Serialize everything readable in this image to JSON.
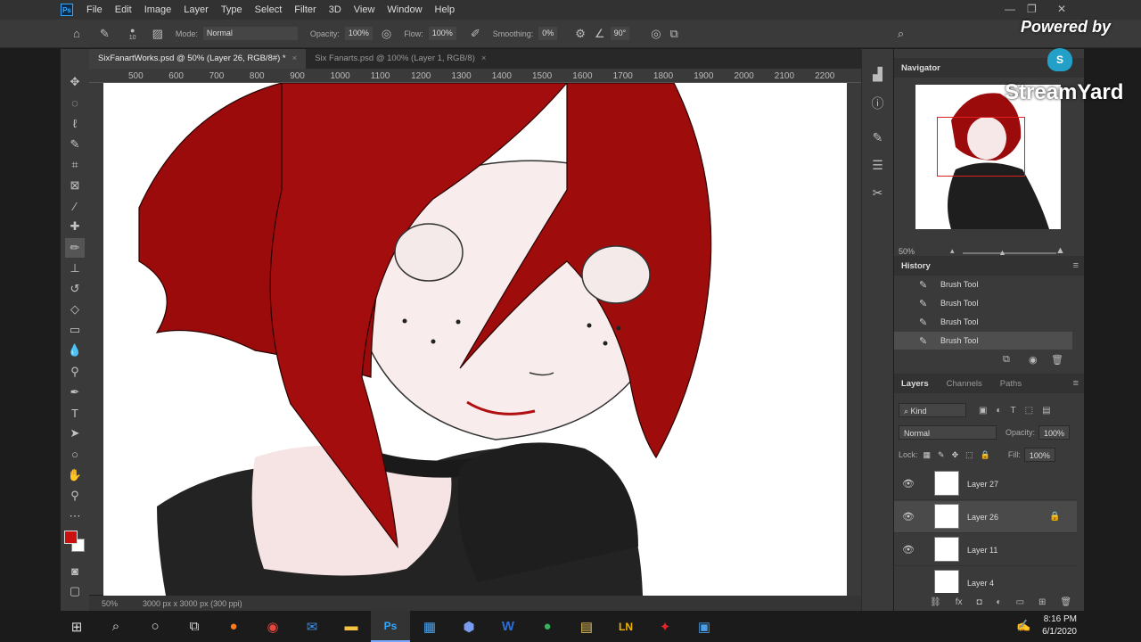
{
  "menubar": {
    "items": [
      "File",
      "Edit",
      "Image",
      "Layer",
      "Type",
      "Select",
      "Filter",
      "3D",
      "View",
      "Window",
      "Help"
    ],
    "logo": "Ps"
  },
  "options": {
    "brush_size": "10",
    "mode_label": "Mode:",
    "mode_value": "Normal",
    "opacity_label": "Opacity:",
    "opacity_value": "100%",
    "flow_label": "Flow:",
    "flow_value": "100%",
    "smoothing_label": "Smoothing:",
    "smoothing_value": "0%",
    "angle_value": "90°"
  },
  "tabs": [
    {
      "label": "SixFanartWorks.psd @ 50% (Layer 26, RGB/8#) *",
      "active": true
    },
    {
      "label": "Six Fanarts.psd @ 100% (Layer 1, RGB/8)",
      "active": false
    }
  ],
  "ruler": {
    "ticks": [
      "500",
      "600",
      "700",
      "800",
      "900",
      "1000",
      "1100",
      "1200",
      "1300",
      "1400",
      "1500",
      "1600",
      "1700",
      "1800",
      "1900",
      "2000",
      "2100",
      "2200"
    ]
  },
  "status": {
    "zoom": "50%",
    "doc_size": "3000 px x 3000 px (300 ppi)"
  },
  "navigator": {
    "title": "Navigator",
    "zoom": "50%"
  },
  "history": {
    "title": "History",
    "items": [
      "Brush Tool",
      "Brush Tool",
      "Brush Tool",
      "Brush Tool"
    ]
  },
  "layers": {
    "tab_layers": "Layers",
    "tab_channels": "Channels",
    "tab_paths": "Paths",
    "kind_label": "Kind",
    "blend_mode": "Normal",
    "opacity_label": "Opacity:",
    "opacity_value": "100%",
    "lock_label": "Lock:",
    "fill_label": "Fill:",
    "fill_value": "100%",
    "items": [
      {
        "name": "Layer 27"
      },
      {
        "name": "Layer 26"
      },
      {
        "name": "Layer 11"
      },
      {
        "name": "Layer 4"
      }
    ]
  },
  "overlay": {
    "powered_by": "Powered by",
    "brand": "StreamYard"
  },
  "taskbar": {
    "time": "8:16 PM",
    "date": "6/1/2020"
  },
  "colors": {
    "foreground": "#cc0f0f",
    "background": "#ffffff",
    "hair": "#9b0b0b"
  }
}
